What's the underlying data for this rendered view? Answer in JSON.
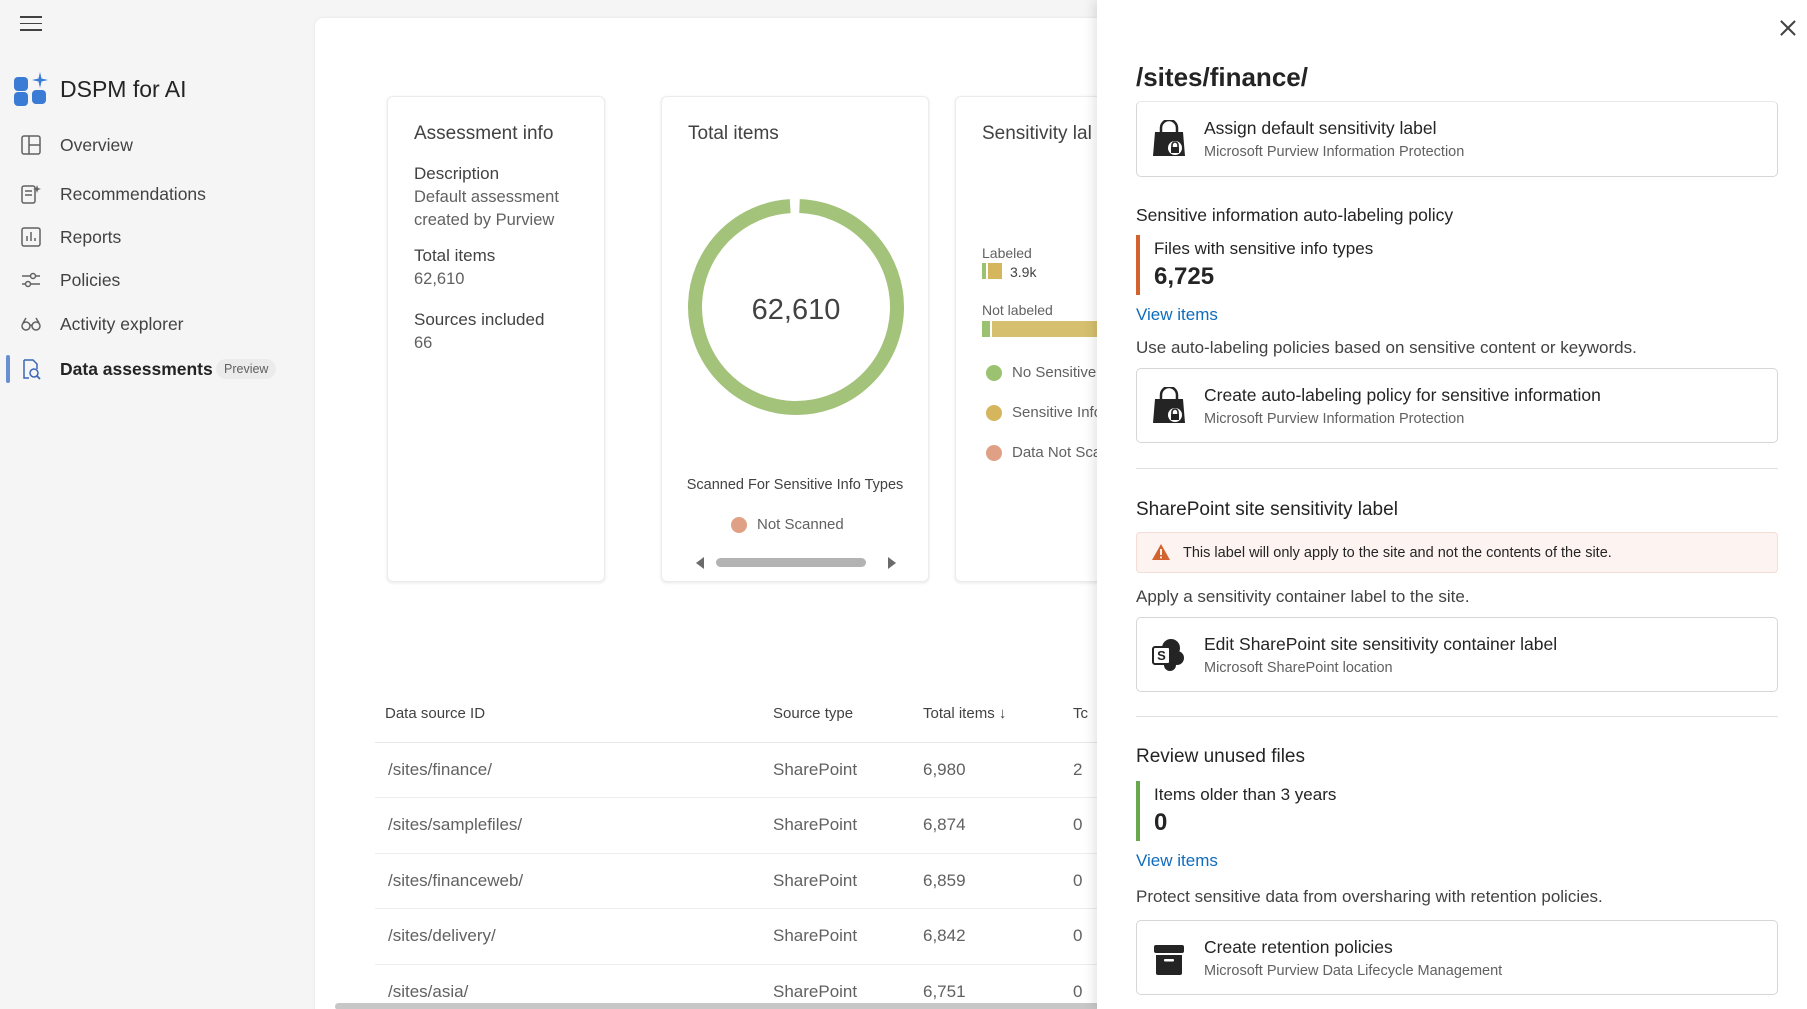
{
  "nav": {
    "app_title": "DSPM for AI",
    "items": [
      {
        "label": "Overview"
      },
      {
        "label": "Recommendations"
      },
      {
        "label": "Reports"
      },
      {
        "label": "Policies"
      },
      {
        "label": "Activity explorer"
      },
      {
        "label": "Data assessments",
        "badge": "Preview",
        "active": true
      }
    ]
  },
  "main": {
    "assessment_card": {
      "title": "Assessment info",
      "description_label": "Description",
      "description_line1": "Default assessment",
      "description_line2": "created by Purview",
      "total_items_label": "Total items",
      "total_items_value": "62,610",
      "sources_label": "Sources included",
      "sources_value": "66"
    },
    "total_card": {
      "title": "Total items",
      "donut_value": "62,610",
      "donut_caption": "Scanned For Sensitive Info Types",
      "legend_item": "Not Scanned",
      "donut_color": "#a3c27a",
      "legend_color": "#e0a085"
    },
    "sensitivity_card": {
      "title": "Sensitivity lal",
      "labeled_label": "Labeled",
      "labeled_value": "3.9k",
      "not_labeled_label": "Not labeled",
      "legend": [
        {
          "label": "No Sensitive",
          "color": "#9bc270"
        },
        {
          "label": "Sensitive Info",
          "color": "#d6b65c"
        },
        {
          "label": "Data Not Sca",
          "color": "#e0a085"
        }
      ]
    },
    "table": {
      "columns": [
        "Data source ID",
        "Source type",
        "Total items",
        "Tc"
      ],
      "rows": [
        {
          "id": "/sites/finance/",
          "type": "SharePoint",
          "total": "6,980",
          "extra": "2"
        },
        {
          "id": "/sites/samplefiles/",
          "type": "SharePoint",
          "total": "6,874",
          "extra": "0"
        },
        {
          "id": "/sites/financeweb/",
          "type": "SharePoint",
          "total": "6,859",
          "extra": "0"
        },
        {
          "id": "/sites/delivery/",
          "type": "SharePoint",
          "total": "6,842",
          "extra": "0"
        },
        {
          "id": "/sites/asia/",
          "type": "SharePoint",
          "total": "6,751",
          "extra": "0"
        }
      ]
    }
  },
  "panel": {
    "title": "/sites/finance/",
    "assign_card": {
      "title": "Assign default sensitivity label",
      "subtitle": "Microsoft Purview Information Protection"
    },
    "autolabel_section": {
      "title": "Sensitive information auto-labeling policy",
      "metric_label": "Files with sensitive info types",
      "metric_value": "6,725",
      "link": "View items",
      "description": "Use auto-labeling policies based on sensitive content or keywords.",
      "card_title": "Create auto-labeling policy for sensitive information",
      "card_subtitle": "Microsoft Purview Information Protection"
    },
    "sharepoint_section": {
      "title": "SharePoint site sensitivity label",
      "warning": "This label will only apply to the site and not the contents of the site.",
      "description": "Apply a sensitivity container label to the site.",
      "card_title": "Edit SharePoint site sensitivity container label",
      "card_subtitle": "Microsoft SharePoint location"
    },
    "unused_section": {
      "title": "Review unused files",
      "metric_label": "Items older than 3 years",
      "metric_value": "0",
      "link": "View items",
      "description": "Protect sensitive data from oversharing with retention policies.",
      "card_title": "Create retention policies",
      "card_subtitle": "Microsoft Purview Data Lifecycle Management"
    }
  }
}
